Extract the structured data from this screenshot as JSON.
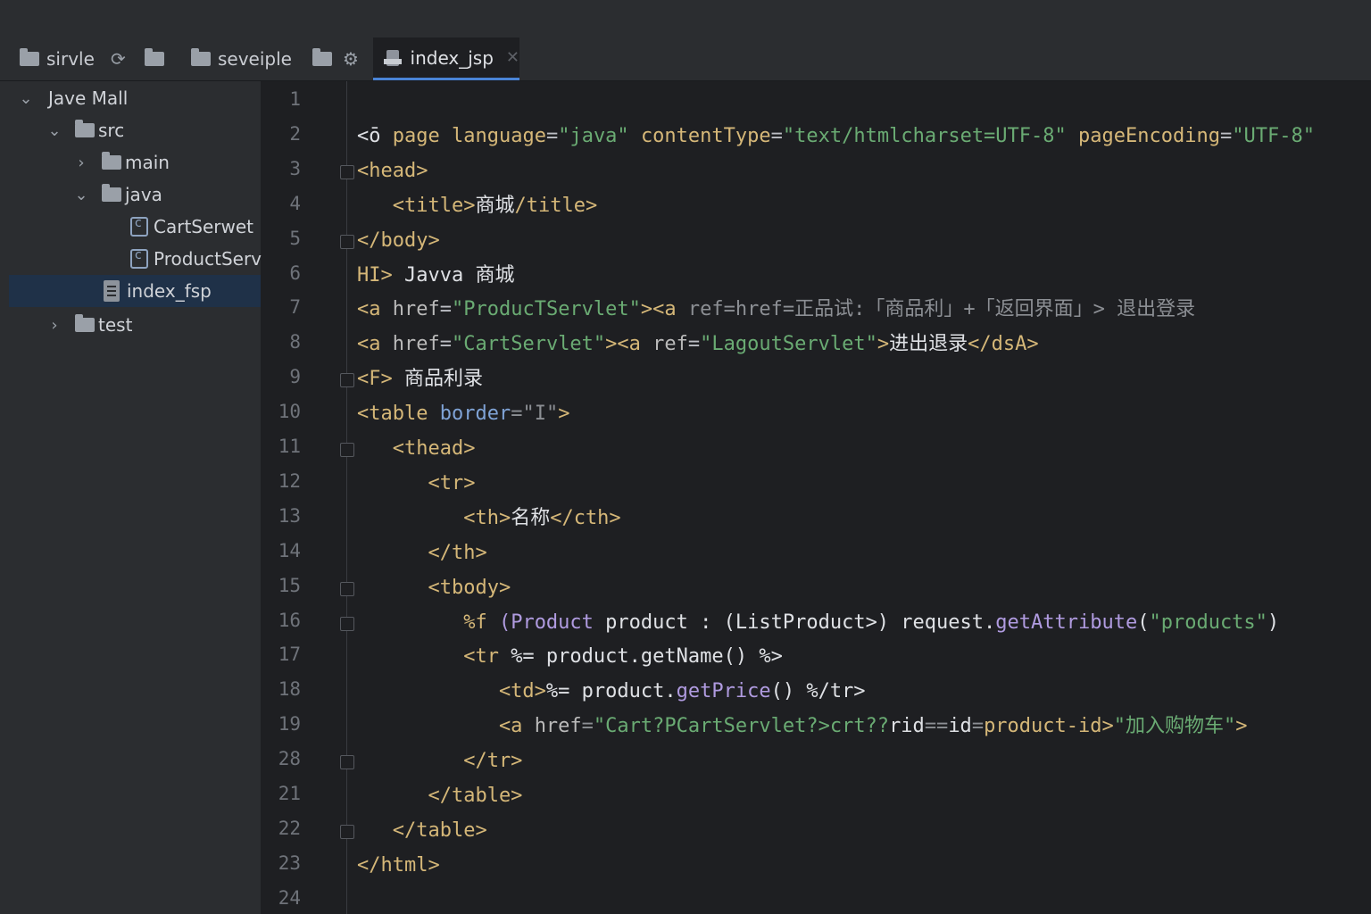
{
  "toolbar": {
    "items": [
      {
        "label": "sirvle"
      },
      {
        "label": "seveiple"
      }
    ]
  },
  "tab": {
    "active_label": "index_jsp",
    "close_glyph": "✕"
  },
  "project_tree": {
    "items": [
      {
        "label": "Jave Mall",
        "chevron": "⌄"
      },
      {
        "label": "src",
        "chevron": "⌄"
      },
      {
        "label": "main",
        "chevron": "›"
      },
      {
        "label": "java",
        "chevron": "⌄"
      },
      {
        "label": "CartSerwet"
      },
      {
        "label": "ProductServ"
      },
      {
        "label": "index_fsp"
      },
      {
        "label": "test",
        "chevron": "›"
      }
    ]
  },
  "editor": {
    "line_numbers": [
      "1",
      "2",
      "3",
      "4",
      "5",
      "6",
      "7",
      "8",
      "9",
      "10",
      "11",
      "12",
      "13",
      "14",
      "15",
      "16",
      "17",
      "18",
      "19",
      "28",
      "21",
      "22",
      "23",
      "24"
    ],
    "lines": [
      [],
      [
        {
          "t": "<ō ",
          "c": "w"
        },
        {
          "t": "page ",
          "c": "t"
        },
        {
          "t": "language",
          "c": "t"
        },
        {
          "t": "=",
          "c": "p"
        },
        {
          "t": "\"java\"",
          "c": "v"
        },
        {
          "t": " ",
          "c": "p"
        },
        {
          "t": "contentType",
          "c": "t"
        },
        {
          "t": "=",
          "c": "p"
        },
        {
          "t": "\"text/htmlcharset=UTF-8\"",
          "c": "v"
        },
        {
          "t": " ",
          "c": "p"
        },
        {
          "t": "pageEncoding",
          "c": "t"
        },
        {
          "t": "=",
          "c": "p"
        },
        {
          "t": "\"UTF-8\"",
          "c": "v"
        }
      ],
      [
        {
          "t": "<head>",
          "c": "t"
        }
      ],
      [
        {
          "t": "   <title>",
          "c": "t"
        },
        {
          "t": "商城",
          "c": "w"
        },
        {
          "t": "/title>",
          "c": "t"
        }
      ],
      [
        {
          "t": "</body>",
          "c": "t"
        }
      ],
      [
        {
          "t": "HI> ",
          "c": "t"
        },
        {
          "t": "Јavva 商城",
          "c": "w"
        }
      ],
      [
        {
          "t": "<a ",
          "c": "t"
        },
        {
          "t": "href",
          "c": "a"
        },
        {
          "t": "=",
          "c": "p"
        },
        {
          "t": "\"ProducTServlet\"",
          "c": "v"
        },
        {
          "t": "><a ",
          "c": "t"
        },
        {
          "t": "ref=href=正品试:「商品利」+「返回界面」> 退出登录",
          "c": "g"
        }
      ],
      [
        {
          "t": "<a ",
          "c": "t"
        },
        {
          "t": "href",
          "c": "a"
        },
        {
          "t": "=",
          "c": "p"
        },
        {
          "t": "\"CartServlet\"",
          "c": "v"
        },
        {
          "t": "><a ",
          "c": "t"
        },
        {
          "t": "ref",
          "c": "a"
        },
        {
          "t": "=",
          "c": "p"
        },
        {
          "t": "\"LagoutServlet\"",
          "c": "v"
        },
        {
          "t": ">",
          "c": "t"
        },
        {
          "t": "进出退录",
          "c": "w"
        },
        {
          "t": "</dsA>",
          "c": "t"
        }
      ],
      [
        {
          "t": "<F> ",
          "c": "t"
        },
        {
          "t": "商品利录",
          "c": "w"
        }
      ],
      [
        {
          "t": "<table ",
          "c": "t"
        },
        {
          "t": "border",
          "c": "b"
        },
        {
          "t": "=",
          "c": "g"
        },
        {
          "t": "\"I\"",
          "c": "g"
        },
        {
          "t": ">",
          "c": "t"
        }
      ],
      [
        {
          "t": "   <thead>",
          "c": "t"
        }
      ],
      [
        {
          "t": "      <tr>",
          "c": "t"
        }
      ],
      [
        {
          "t": "         <th>",
          "c": "t"
        },
        {
          "t": "名称",
          "c": "w"
        },
        {
          "t": "</cth>",
          "c": "t"
        }
      ],
      [
        {
          "t": "      </th>",
          "c": "t"
        }
      ],
      [
        {
          "t": "      <tbody>",
          "c": "t"
        }
      ],
      [
        {
          "t": "         %f ",
          "c": "t"
        },
        {
          "t": "(Product ",
          "c": "m"
        },
        {
          "t": "product : (ListProduct>) request.",
          "c": "w"
        },
        {
          "t": "getAttribute",
          "c": "m"
        },
        {
          "t": "(",
          "c": "w"
        },
        {
          "t": "\"products\"",
          "c": "v"
        },
        {
          "t": ")",
          "c": "w"
        }
      ],
      [
        {
          "t": "         <tr ",
          "c": "t"
        },
        {
          "t": "%= product.getName() %>",
          "c": "w"
        }
      ],
      [
        {
          "t": "            <td>",
          "c": "t"
        },
        {
          "t": "%= product.",
          "c": "w"
        },
        {
          "t": "getPrice",
          "c": "m"
        },
        {
          "t": "() %/tr>",
          "c": "w"
        }
      ],
      [
        {
          "t": "            <a ",
          "c": "t"
        },
        {
          "t": "href",
          "c": "a"
        },
        {
          "t": "=",
          "c": "g"
        },
        {
          "t": "\"Cart?PCartServlet?>crt??",
          "c": "v"
        },
        {
          "t": "rid",
          "c": "w"
        },
        {
          "t": "==",
          "c": "g"
        },
        {
          "t": "id",
          "c": "w"
        },
        {
          "t": "=",
          "c": "g"
        },
        {
          "t": "product-id>",
          "c": "t"
        },
        {
          "t": "\"加入购物车\"",
          "c": "v"
        },
        {
          "t": ">",
          "c": "t"
        }
      ],
      [
        {
          "t": "         </tr>",
          "c": "t"
        }
      ],
      [
        {
          "t": "      </table>",
          "c": "t"
        }
      ],
      [
        {
          "t": "   </table>",
          "c": "t"
        }
      ],
      [
        {
          "t": "</html>",
          "c": "t"
        }
      ],
      []
    ]
  }
}
